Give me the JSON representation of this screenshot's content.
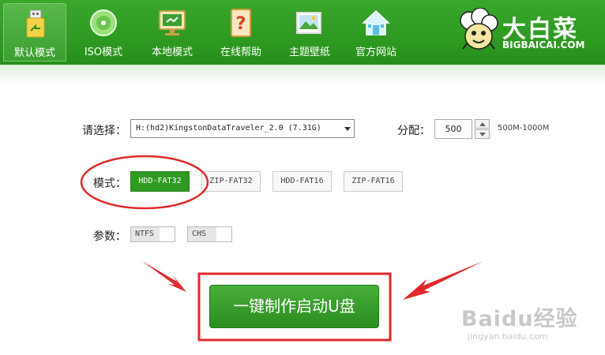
{
  "tabs": [
    {
      "label": "默认模式",
      "icon": "usb-icon",
      "active": true
    },
    {
      "label": "ISO模式",
      "icon": "disc-icon",
      "active": false
    },
    {
      "label": "本地模式",
      "icon": "monitor-icon",
      "active": false
    },
    {
      "label": "在线帮助",
      "icon": "help-icon",
      "active": false
    },
    {
      "label": "主题壁纸",
      "icon": "picture-icon",
      "active": false
    },
    {
      "label": "官方网站",
      "icon": "home-icon",
      "active": false
    }
  ],
  "logo": {
    "brand": "大白菜",
    "site": "BIGBAICAI.COM"
  },
  "form": {
    "select_label": "请选择：",
    "device": "H:(hd2)KingstonDataTraveler_2.0 (7.31G)",
    "alloc_label": "分配：",
    "alloc_value": "500",
    "alloc_range": "500M-1000M",
    "mode_label": "模式：",
    "modes": [
      {
        "label": "HDD-FAT32",
        "active": true
      },
      {
        "label": "ZIP-FAT32",
        "active": false
      },
      {
        "label": "HDD-FAT16",
        "active": false
      },
      {
        "label": "ZIP-FAT16",
        "active": false
      }
    ],
    "param_label": "参数：",
    "params": [
      {
        "label": "NTFS",
        "checked": false
      },
      {
        "label": "CHS",
        "checked": false
      }
    ],
    "make_button": "一键制作启动U盘"
  },
  "watermark": {
    "main": "Baidu经验",
    "sub": "jingyan.baidu.com"
  },
  "colors": {
    "header_green": "#2f9a22",
    "accent_red": "#e02a2a"
  }
}
